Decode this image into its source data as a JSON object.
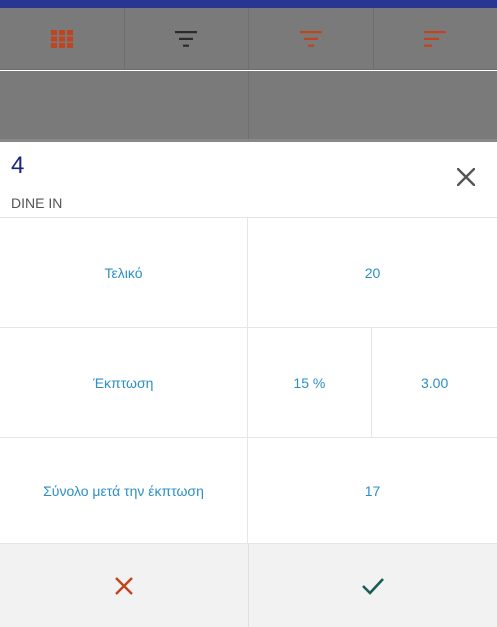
{
  "colors": {
    "top_bar": "#283593",
    "accent_orange": "#c0441e",
    "link_blue": "#2b8fc4",
    "confirm_teal": "#1b5e55",
    "title_navy": "#1a237e"
  },
  "toolbar": {
    "items": [
      {
        "icon": "grid-icon"
      },
      {
        "icon": "filter-icon"
      },
      {
        "icon": "filter-icon"
      },
      {
        "icon": "sort-icon"
      }
    ]
  },
  "dialog": {
    "order_number": "4",
    "order_type": "DINE IN",
    "total_label": "Τελικό",
    "total_value": "20",
    "discount_label": "Έκπτωση",
    "discount_percent": "15 %",
    "discount_amount": "3.00",
    "after_discount_label": "Σύνολο μετά την έκπτωση",
    "after_discount_value": "17",
    "close_icon": "close-icon",
    "cancel_icon": "cancel-icon",
    "confirm_icon": "check-icon"
  }
}
